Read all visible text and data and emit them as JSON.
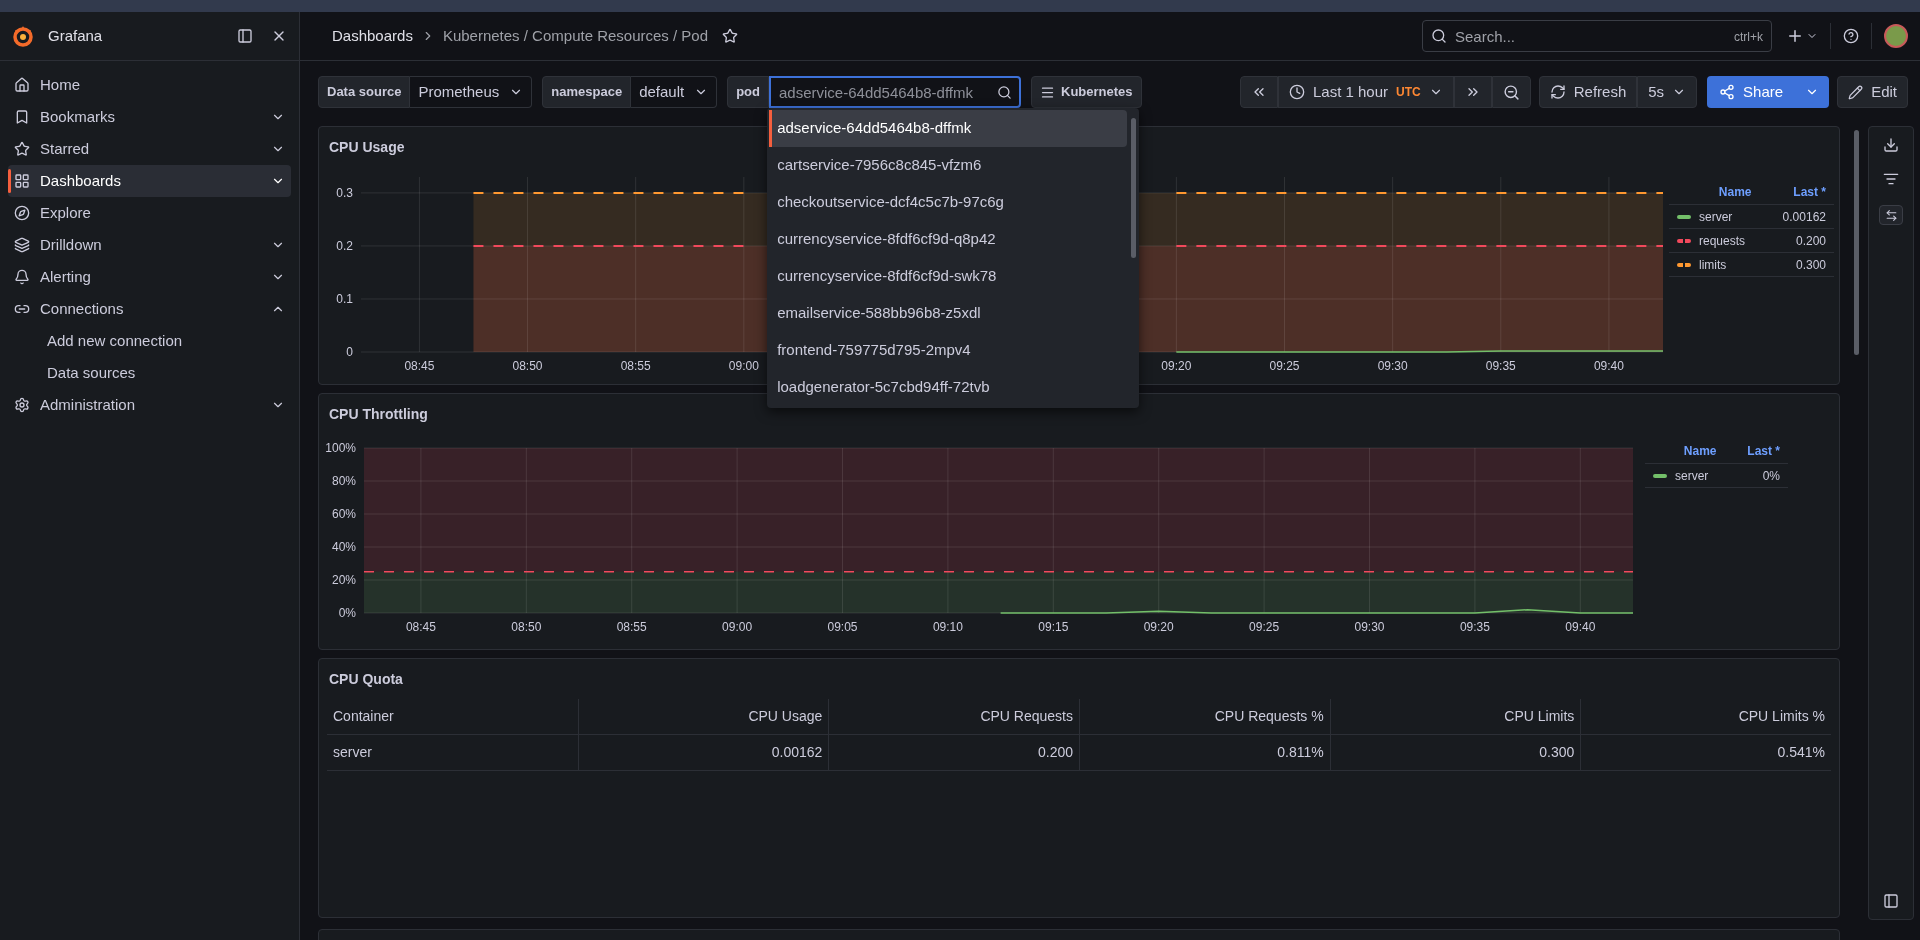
{
  "top_bar": {
    "app_name": "Grafana",
    "breadcrumb": [
      {
        "label": "Dashboards"
      },
      {
        "label": "Kubernetes / Compute Resources / Pod"
      }
    ],
    "search": {
      "placeholder": "Search...",
      "shortcut": "ctrl+k"
    }
  },
  "sidebar": {
    "items": [
      {
        "label": "Home",
        "selected": false
      },
      {
        "label": "Bookmarks",
        "selected": false,
        "expanded": false
      },
      {
        "label": "Starred",
        "selected": false,
        "expanded": false
      },
      {
        "label": "Dashboards",
        "selected": true,
        "expanded": false
      },
      {
        "label": "Explore",
        "selected": false
      },
      {
        "label": "Drilldown",
        "selected": false,
        "expanded": false
      },
      {
        "label": "Alerting",
        "selected": false,
        "expanded": false
      },
      {
        "label": "Connections",
        "selected": false,
        "expanded": true,
        "children": [
          {
            "label": "Add new connection",
            "selected": false
          },
          {
            "label": "Data sources",
            "selected": false
          }
        ]
      },
      {
        "label": "Administration",
        "selected": false,
        "expanded": false
      }
    ]
  },
  "variables": [
    {
      "label": "Data source",
      "kind": "select",
      "value": "Prometheus"
    },
    {
      "label": "namespace",
      "kind": "select",
      "value": "default"
    },
    {
      "label": "pod",
      "kind": "search",
      "placeholder": "adservice-64dd5464b8-dffmk",
      "focused": true
    }
  ],
  "links": [
    {
      "label": "Kubernetes"
    }
  ],
  "time_picker": {
    "range": "Last 1 hour",
    "timezone": "UTC"
  },
  "refresh": {
    "label": "Refresh",
    "interval": "5s"
  },
  "share": {
    "label": "Share"
  },
  "edit": {
    "label": "Edit"
  },
  "pod_dropdown": {
    "options": [
      {
        "label": "adservice-64dd5464b8-dffmk",
        "selected": true
      },
      {
        "label": "cartservice-7956c8c845-vfzm6",
        "selected": false
      },
      {
        "label": "checkoutservice-dcf4c5c7b-97c6g",
        "selected": false
      },
      {
        "label": "currencyservice-8fdf6cf9d-q8p42",
        "selected": false
      },
      {
        "label": "currencyservice-8fdf6cf9d-swk78",
        "selected": false
      },
      {
        "label": "emailservice-588bb96b8-z5xdl",
        "selected": false
      },
      {
        "label": "frontend-759775d795-2mpv4",
        "selected": false
      },
      {
        "label": "loadgenerator-5c7cbd94ff-72tvb",
        "selected": false
      }
    ]
  },
  "panels": [
    {
      "kind": "timeseries",
      "title": "CPU Usage",
      "chart_data": {
        "type": "area",
        "grid": true,
        "categories": [
          "08:45",
          null,
          "08:50",
          null,
          "08:55",
          null,
          "09:00",
          null,
          null,
          null,
          null,
          null,
          null,
          null,
          "09:20",
          null,
          "09:25",
          null,
          "09:30",
          null,
          "09:35",
          null,
          "09:40",
          null
        ],
        "ylim": [
          0,
          0.33
        ],
        "yticks": [
          0,
          0.1,
          0.2,
          0.3
        ],
        "series": [
          {
            "name": "server",
            "color": "#73bf69",
            "line_style": "solid",
            "values": [
              null,
              null,
              null,
              null,
              null,
              null,
              null,
              null,
              null,
              null,
              null,
              null,
              null,
              null,
              0,
              0,
              0,
              0,
              0,
              0,
              0.002,
              0.002,
              0.002,
              0.002
            ]
          },
          {
            "name": "requests",
            "color": "#f2495c",
            "line_style": "dashed",
            "values": [
              null,
              0.2,
              0.2,
              0.2,
              0.2,
              0.2,
              0.2,
              null,
              null,
              null,
              null,
              null,
              null,
              null,
              0.2,
              0.2,
              0.2,
              0.2,
              0.2,
              0.2,
              0.2,
              0.2,
              0.2,
              0.2
            ]
          },
          {
            "name": "limits",
            "color": "#ff9830",
            "line_style": "dashed",
            "values": [
              null,
              0.3,
              0.3,
              0.3,
              0.3,
              0.3,
              0.3,
              null,
              null,
              null,
              null,
              null,
              null,
              null,
              0.3,
              0.3,
              0.3,
              0.3,
              0.3,
              0.3,
              0.3,
              0.3,
              0.3,
              0.3
            ]
          }
        ]
      },
      "legend": {
        "columns": [
          "Name",
          "Last *"
        ],
        "rows": [
          {
            "last": "0.00162"
          },
          {
            "last": "0.200"
          },
          {
            "last": "0.300"
          }
        ]
      }
    },
    {
      "kind": "timeseries",
      "title": "CPU Throttling",
      "chart_data": {
        "type": "line",
        "grid": true,
        "categories": [
          "08:45",
          null,
          "08:50",
          null,
          "08:55",
          null,
          "09:00",
          null,
          "09:05",
          null,
          "09:10",
          null,
          "09:15",
          null,
          "09:20",
          null,
          "09:25",
          null,
          "09:30",
          null,
          "09:35",
          null,
          "09:40",
          null
        ],
        "ylim": [
          0,
          100
        ],
        "yticks": [
          {
            "value": 0,
            "label": "0%"
          },
          {
            "value": 20,
            "label": "20%"
          },
          {
            "value": 40,
            "label": "40%"
          },
          {
            "value": 60,
            "label": "60%"
          },
          {
            "value": 80,
            "label": "80%"
          },
          {
            "value": 100,
            "label": "100%"
          }
        ],
        "series": [
          {
            "name": "server",
            "color": "#73bf69",
            "line_style": "solid",
            "values": [
              null,
              null,
              null,
              null,
              null,
              null,
              null,
              null,
              null,
              null,
              null,
              0,
              0,
              0,
              1,
              0,
              0,
              0,
              0,
              0,
              0,
              2,
              0,
              0
            ]
          }
        ],
        "ref_lines": [
          {
            "axis": "y",
            "value": 25,
            "color": "#f2495c"
          }
        ],
        "bands": [
          {
            "axis": "y",
            "from": 0,
            "to": 25,
            "color": "#73bf69"
          },
          {
            "axis": "y",
            "from": 25,
            "to": 100,
            "color": "#f2495c"
          }
        ]
      },
      "legend": {
        "columns": [
          "Name",
          "Last *"
        ],
        "rows": [
          {
            "last": "0%"
          }
        ]
      }
    },
    {
      "kind": "table",
      "title": "CPU Quota",
      "columns": [
        "Container",
        "CPU Usage",
        "CPU Requests",
        "CPU Requests %",
        "CPU Limits",
        "CPU Limits %"
      ],
      "rows": [
        [
          "server",
          "0.00162",
          "0.200",
          "0.811%",
          "0.300",
          "0.541%"
        ]
      ]
    }
  ]
}
